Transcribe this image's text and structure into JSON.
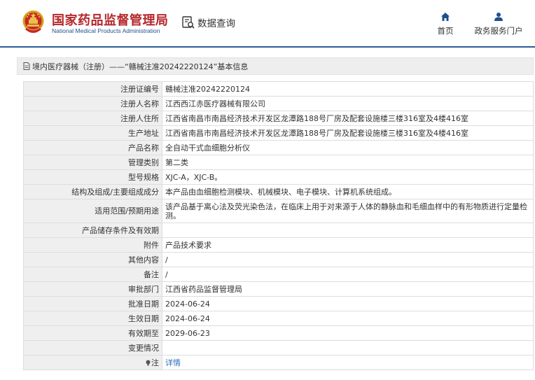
{
  "header": {
    "brand_title": "国家药品监督管理局",
    "brand_subtitle": "National Medical Products Administration",
    "query_label": "数据查询",
    "nav": {
      "home": "首页",
      "portal": "政务服务门户"
    }
  },
  "section": {
    "title": "境内医疗器械（注册）——“赣械注准20242220124”基本信息"
  },
  "rows": [
    {
      "label": "注册证编号",
      "value": "赣械注准20242220124"
    },
    {
      "label": "注册人名称",
      "value": "江西西江赤医疗器械有限公司"
    },
    {
      "label": "注册人住所",
      "value": "江西省南昌市南昌经济技术开发区龙潭路188号厂房及配套设施楼三楼316室及4楼416室"
    },
    {
      "label": "生产地址",
      "value": "江西省南昌市南昌经济技术开发区龙潭路188号厂房及配套设施楼三楼316室及4楼416室"
    },
    {
      "label": "产品名称",
      "value": "全自动干式血细胞分析仪"
    },
    {
      "label": "管理类别",
      "value": "第二类"
    },
    {
      "label": "型号规格",
      "value": "XJC-A，XJC-B。"
    },
    {
      "label": "结构及组成/主要组成成分",
      "value": "本产品由血细胞检测模块、机械模块、电子模块、计算机系统组成。"
    },
    {
      "label": "适用范围/预期用途",
      "value": "该产品基于离心法及荧光染色法，在临床上用于对来源于人体的静脉血和毛细血样中的有形物质进行定量检测。"
    },
    {
      "label": "产品储存条件及有效期",
      "value": ""
    },
    {
      "label": "附件",
      "value": "产品技术要求"
    },
    {
      "label": "其他内容",
      "value": "/"
    },
    {
      "label": "备注",
      "value": "/"
    },
    {
      "label": "审批部门",
      "value": "江西省药品监督管理局"
    },
    {
      "label": "批准日期",
      "value": "2024-06-24"
    },
    {
      "label": "生效日期",
      "value": "2024-06-24"
    },
    {
      "label": "有效期至",
      "value": "2029-06-23"
    },
    {
      "label": "变更情况",
      "value": ""
    }
  ],
  "note": {
    "label": "注",
    "link": "详情"
  },
  "colors": {
    "brand_red": "#b5262b",
    "brand_blue": "#1f4f8c",
    "divider": "#2a5d97",
    "link": "#2a6cb8"
  }
}
